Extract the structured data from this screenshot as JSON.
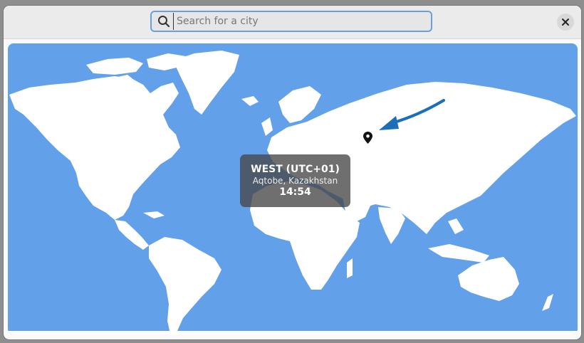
{
  "search": {
    "placeholder": "Search for a city",
    "value": ""
  },
  "close": {
    "icon": "close-icon"
  },
  "map": {
    "ocean_color": "#62a0ea",
    "land_color": "#ffffff",
    "marker_icon": "map-pin-icon"
  },
  "tooltip": {
    "zone": "WEST (UTC+01)",
    "city": "Aqtobe, Kazakhstan",
    "time": "14:54"
  }
}
